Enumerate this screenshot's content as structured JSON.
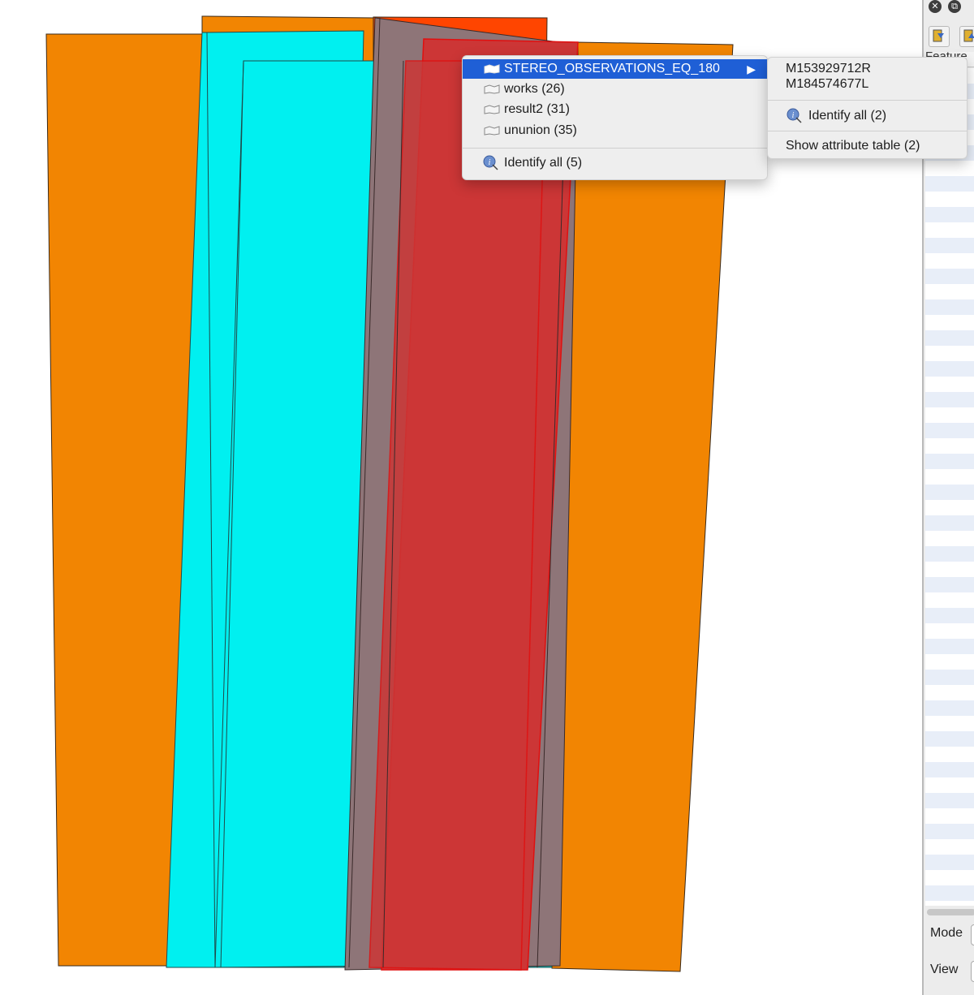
{
  "colors": {
    "orange_footprint": "#f28502",
    "orange_red_footprint": "#ff4500",
    "cyan_footprint": "#00f0f0",
    "red_footprint": "#cc3636",
    "gray_footprint": "#8e7578",
    "crimson_footprint": "#e8144a",
    "menu_highlight": "#1f5fd6"
  },
  "layer_menu": {
    "items": [
      {
        "label": "STEREO_OBSERVATIONS_EQ_180",
        "icon": "polygon-layer-icon",
        "highlighted": true,
        "has_submenu": true
      },
      {
        "label": "works (26)",
        "icon": "polygon-layer-icon"
      },
      {
        "label": "result2 (31)",
        "icon": "polygon-layer-icon"
      },
      {
        "label": "ununion (35)",
        "icon": "polygon-layer-icon"
      }
    ],
    "identify_all": "Identify all (5)",
    "submenu_arrow": "▶"
  },
  "sub_menu": {
    "features": [
      "M153929712R",
      "M184574677L"
    ],
    "identify_all": "Identify all (2)",
    "show_attribute_table": "Show attribute table (2)"
  },
  "right_panel": {
    "feature_header": "Feature",
    "mode_label": "Mode",
    "view_label": "View",
    "close_icon": "close-icon",
    "float_icon": "float-icon"
  }
}
